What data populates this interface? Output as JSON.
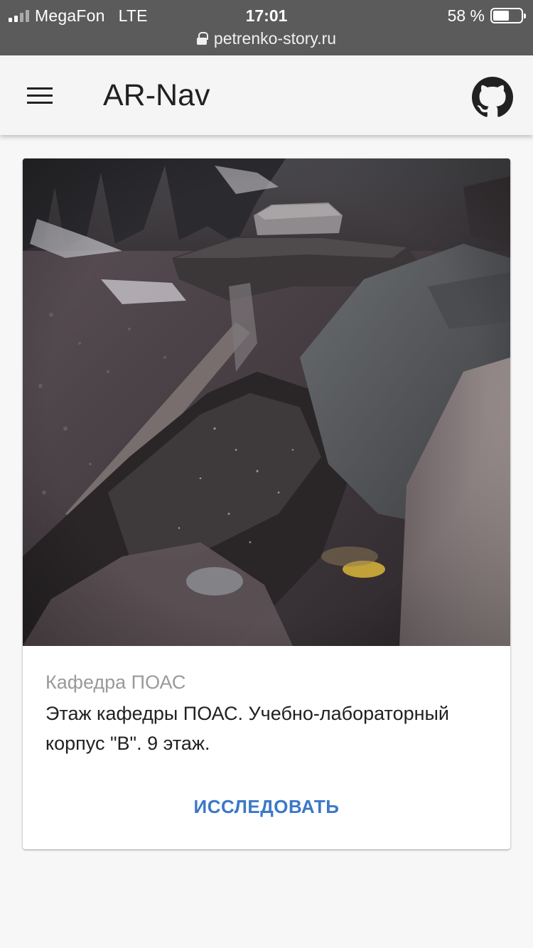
{
  "status_bar": {
    "carrier": "MegaFon",
    "network": "LTE",
    "time": "17:01",
    "battery_percent": "58 %",
    "battery_level": 0.58
  },
  "browser": {
    "url": "petrenko-story.ru"
  },
  "app_bar": {
    "title": "AR-Nav",
    "menu_icon": "hamburger-menu-icon",
    "github_icon": "github-icon"
  },
  "card": {
    "image": "rocky-stream-photo",
    "subtitle": "Кафедра ПОАС",
    "text": "Этаж кафедры ПОАС. Учебно-лабораторный корпус \"В\". 9 этаж.",
    "action_label": "ИССЛЕДОВАТЬ"
  },
  "colors": {
    "status_bar_bg": "#5b5b5b",
    "app_bar_bg": "#f5f5f5",
    "page_bg": "#f7f7f7",
    "action": "#3b78c8",
    "subtitle": "#9a9a9a"
  }
}
